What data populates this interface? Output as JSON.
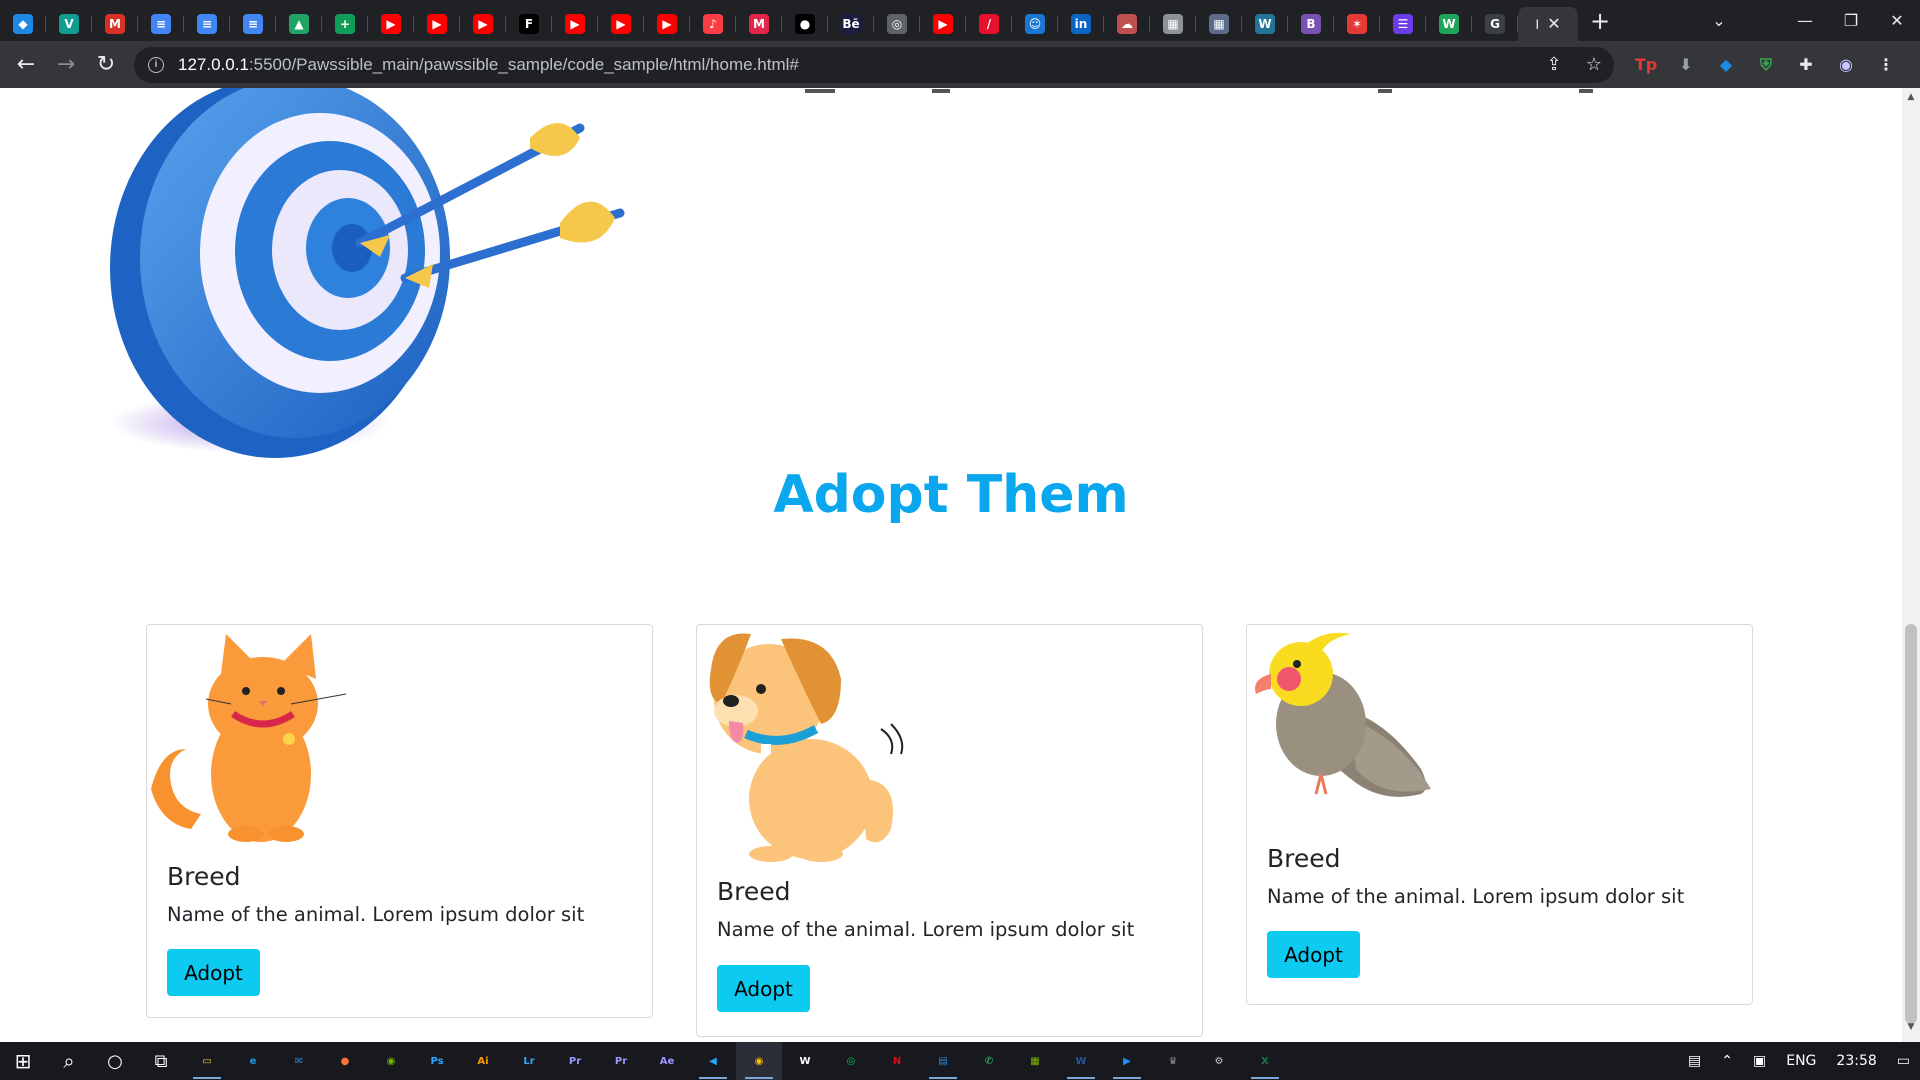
{
  "browser": {
    "tabs": [
      {
        "icon": "gem-icon",
        "glyph": "◆",
        "color": "#1e88e5"
      },
      {
        "icon": "vpn-icon",
        "glyph": "V",
        "color": "#0f9d8f"
      },
      {
        "icon": "gmail-icon",
        "glyph": "M",
        "color": "#d93025"
      },
      {
        "icon": "docs-icon",
        "glyph": "≡",
        "color": "#4285f4"
      },
      {
        "icon": "docs-icon",
        "glyph": "≡",
        "color": "#4285f4"
      },
      {
        "icon": "docs-icon",
        "glyph": "≡",
        "color": "#4285f4"
      },
      {
        "icon": "drive-icon",
        "glyph": "▲",
        "color": "#1fa463"
      },
      {
        "icon": "sheets-icon",
        "glyph": "+",
        "color": "#0f9d58"
      },
      {
        "icon": "youtube-icon",
        "glyph": "▶",
        "color": "#ff0000"
      },
      {
        "icon": "youtube-icon",
        "glyph": "▶",
        "color": "#ff0000"
      },
      {
        "icon": "youtube-icon",
        "glyph": "▶",
        "color": "#ff0000"
      },
      {
        "icon": "font-icon",
        "glyph": "F",
        "color": "#000000"
      },
      {
        "icon": "youtube-icon",
        "glyph": "▶",
        "color": "#ff0000"
      },
      {
        "icon": "youtube-icon",
        "glyph": "▶",
        "color": "#ff0000"
      },
      {
        "icon": "youtube-icon",
        "glyph": "▶",
        "color": "#ff0000"
      },
      {
        "icon": "music-icon",
        "glyph": "♪",
        "color": "#fc3c44"
      },
      {
        "icon": "medium-icon",
        "glyph": "M",
        "color": "#e2234a"
      },
      {
        "icon": "apple-icon",
        "glyph": "●",
        "color": "#202124"
      },
      {
        "icon": "behance-icon",
        "glyph": "Bē",
        "color": "#1a1d40"
      },
      {
        "icon": "globe-icon",
        "glyph": "◎",
        "color": "#5f6368"
      },
      {
        "icon": "youtube-icon",
        "glyph": "▶",
        "color": "#ff0000"
      },
      {
        "icon": "brush-icon",
        "glyph": "/",
        "color": "#e8112d"
      },
      {
        "icon": "reddit-icon",
        "glyph": "☺",
        "color": "#1976d2"
      },
      {
        "icon": "linkedin-icon",
        "glyph": "in",
        "color": "#0a66c2"
      },
      {
        "icon": "cloud-icon",
        "glyph": "☁",
        "color": "#c0504d"
      },
      {
        "icon": "image-icon",
        "glyph": "▦",
        "color": "#8d9399"
      },
      {
        "icon": "image-icon",
        "glyph": "▦",
        "color": "#5c6b8a"
      },
      {
        "icon": "wordpress-icon",
        "glyph": "W",
        "color": "#21759b"
      },
      {
        "icon": "bootstrap-icon",
        "glyph": "B",
        "color": "#7952b3"
      },
      {
        "icon": "star-icon",
        "glyph": "✶",
        "color": "#e53935"
      },
      {
        "icon": "list-icon",
        "glyph": "☰",
        "color": "#6a3de8"
      },
      {
        "icon": "wix-icon",
        "glyph": "W",
        "color": "#1ea55a"
      },
      {
        "icon": "google-icon",
        "glyph": "G",
        "color": "#ffffff"
      }
    ],
    "active_tab_label": "I",
    "url_host": "127.0.0.1",
    "url_path": ":5500/Pawssible_main/pawssible_sample/code_sample/html/home.html#"
  },
  "page": {
    "section_title": "Adopt Them",
    "cards": [
      {
        "breed": "Breed",
        "description": "Name of the animal. Lorem ipsum dolor sit",
        "button": "Adopt"
      },
      {
        "breed": "Breed",
        "description": "Name of the animal. Lorem ipsum dolor sit",
        "button": "Adopt"
      },
      {
        "breed": "Breed",
        "description": "Name of the animal. Lorem ipsum dolor sit",
        "button": "Adopt"
      }
    ]
  },
  "colors": {
    "title": "#0aa6ee",
    "button": "#0dcaf0",
    "chrome_dark": "#202124",
    "chrome_toolbar": "#35363a"
  },
  "taskbar": {
    "apps": [
      {
        "icon": "file-explorer-icon",
        "glyph": "▭",
        "color": "#f4c542",
        "running": true
      },
      {
        "icon": "edge-icon",
        "glyph": "e",
        "color": "#1fa0e0",
        "running": false
      },
      {
        "icon": "mail-icon",
        "glyph": "✉",
        "color": "#2b88d8",
        "running": false
      },
      {
        "icon": "firefox-icon",
        "glyph": "●",
        "color": "#ff7139",
        "running": false
      },
      {
        "icon": "nvidia-icon",
        "glyph": "◉",
        "color": "#76b900",
        "running": false
      },
      {
        "icon": "photoshop-icon",
        "glyph": "Ps",
        "color": "#31a8ff",
        "running": false
      },
      {
        "icon": "illustrator-icon",
        "glyph": "Ai",
        "color": "#ff9a00",
        "running": false
      },
      {
        "icon": "lightroom-icon",
        "glyph": "Lr",
        "color": "#31a8ff",
        "running": false
      },
      {
        "icon": "premiere-icon",
        "glyph": "Pr",
        "color": "#9999ff",
        "running": false
      },
      {
        "icon": "premiere-icon",
        "glyph": "Pr",
        "color": "#9999ff",
        "running": false
      },
      {
        "icon": "after-effects-icon",
        "glyph": "Ae",
        "color": "#9999ff",
        "running": false
      },
      {
        "icon": "vscode-icon",
        "glyph": "◀",
        "color": "#22a7f2",
        "running": true
      },
      {
        "icon": "chrome-icon",
        "glyph": "◉",
        "color": "#fbbc04",
        "running": true
      },
      {
        "icon": "wordpad-icon",
        "glyph": "W",
        "color": "#ffffff",
        "running": false
      },
      {
        "icon": "spotify-icon",
        "glyph": "◎",
        "color": "#1db954",
        "running": false
      },
      {
        "icon": "netflix-icon",
        "glyph": "N",
        "color": "#e50914",
        "running": false
      },
      {
        "icon": "calculator-icon",
        "glyph": "▤",
        "color": "#2b88d8",
        "running": true
      },
      {
        "icon": "whatsapp-icon",
        "glyph": "✆",
        "color": "#25d366",
        "running": false
      },
      {
        "icon": "notepad-icon",
        "glyph": "▦",
        "color": "#7fba00",
        "running": false
      },
      {
        "icon": "word-icon",
        "glyph": "W",
        "color": "#2b579a",
        "running": true
      },
      {
        "icon": "media-icon",
        "glyph": "▶",
        "color": "#1e90ff",
        "running": true
      },
      {
        "icon": "predator-icon",
        "glyph": "♛",
        "color": "#8e8e8e",
        "running": false
      },
      {
        "icon": "settings-icon",
        "glyph": "⚙",
        "color": "#c5c5c5",
        "running": false
      },
      {
        "icon": "excel-icon",
        "glyph": "X",
        "color": "#217346",
        "running": true
      }
    ],
    "language": "ENG",
    "time": "23:58"
  }
}
